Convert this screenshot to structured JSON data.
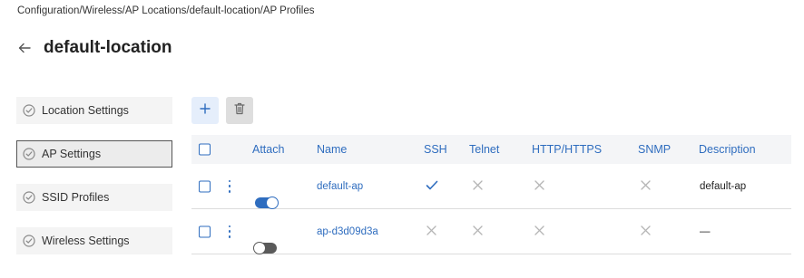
{
  "breadcrumb": "Configuration/Wireless/AP Locations/default-location/AP Profiles",
  "page_title": "default-location",
  "sidebar": {
    "items": [
      {
        "label": "Location Settings",
        "active": false
      },
      {
        "label": "AP Settings",
        "active": true
      },
      {
        "label": "SSID Profiles",
        "active": false
      },
      {
        "label": "Wireless Settings",
        "active": false
      }
    ]
  },
  "toolbar": {
    "add_icon": "plus-icon",
    "delete_icon": "trash-icon"
  },
  "table": {
    "headers": {
      "attach": "Attach",
      "name": "Name",
      "ssh": "SSH",
      "telnet": "Telnet",
      "https": "HTTP/HTTPS",
      "snmp": "SNMP",
      "description": "Description"
    },
    "rows": [
      {
        "attach": true,
        "name": "default-ap",
        "ssh": "check",
        "telnet": "x",
        "https": "x",
        "snmp": "x",
        "description": "default-ap"
      },
      {
        "attach": false,
        "name": "ap-d3d09d3a",
        "ssh": "x",
        "telnet": "x",
        "https": "x",
        "snmp": "x",
        "description": "—"
      }
    ]
  },
  "colors": {
    "accent": "#2f6dbf",
    "sidebar_bg": "#f4f4f4",
    "header_bg": "#f4f5f7"
  }
}
